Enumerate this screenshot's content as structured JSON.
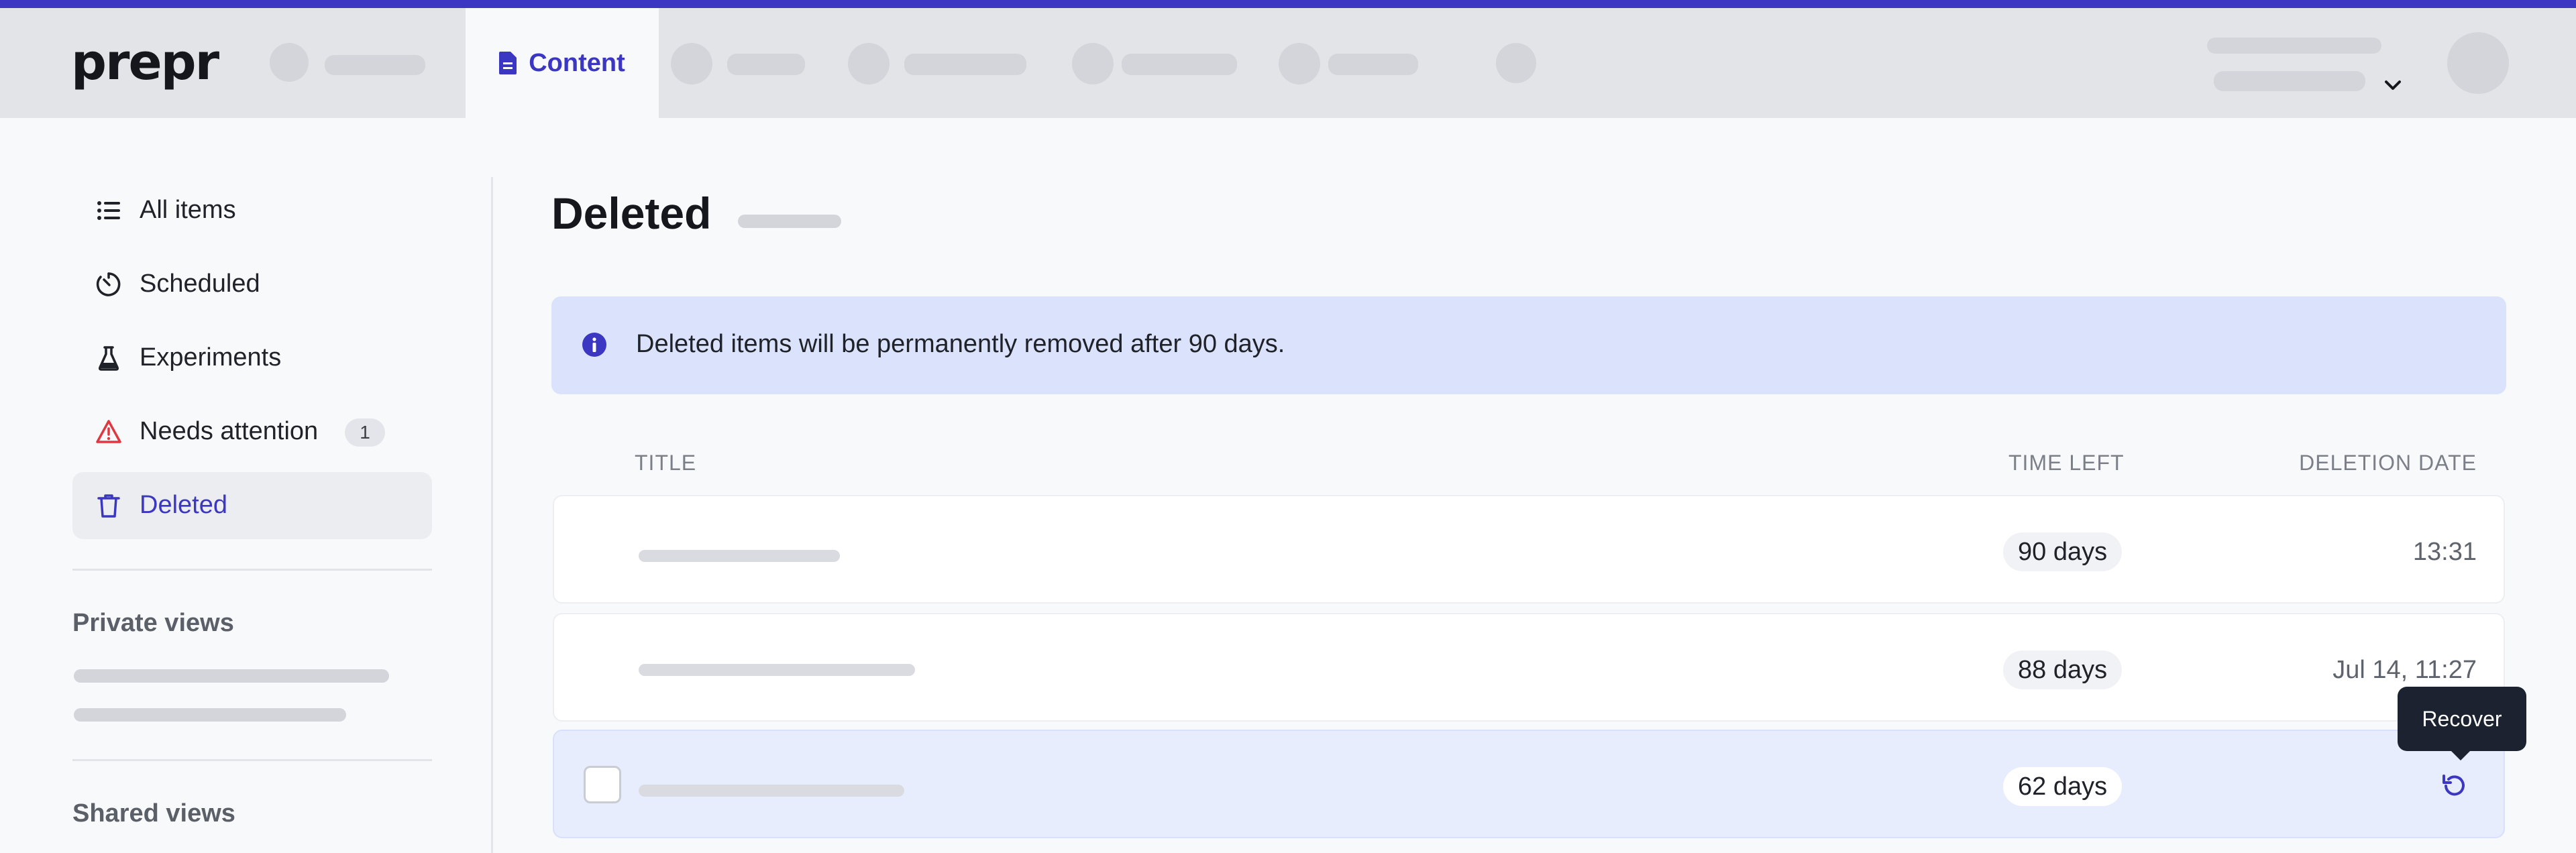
{
  "app": {
    "logo_text": "prepr"
  },
  "topnav": {
    "active_tab": {
      "label": "Content",
      "icon": "document-icon"
    }
  },
  "sidebar": {
    "items": [
      {
        "label": "All items",
        "icon": "list-icon"
      },
      {
        "label": "Scheduled",
        "icon": "timer-icon"
      },
      {
        "label": "Experiments",
        "icon": "flask-icon"
      },
      {
        "label": "Needs attention",
        "icon": "warning-icon",
        "badge": "1"
      },
      {
        "label": "Deleted",
        "icon": "trash-icon",
        "active": true
      }
    ],
    "private_views_title": "Private views",
    "shared_views_title": "Shared views"
  },
  "main": {
    "title": "Deleted",
    "info_banner": "Deleted items will be permanently removed after 90 days.",
    "columns": {
      "title": "TITLE",
      "time_left": "TIME LEFT",
      "deletion_date": "DELETION DATE"
    },
    "rows": [
      {
        "time_left": "90 days",
        "deletion_date": "13:31"
      },
      {
        "time_left": "88 days",
        "deletion_date": "Jul 14, 11:27"
      },
      {
        "time_left": "62 days",
        "deletion_date": ""
      }
    ],
    "tooltip": "Recover"
  },
  "colors": {
    "accent": "#3b37c2",
    "banner_bg": "#dbe3fc",
    "warning": "#e0383e",
    "tooltip_bg": "#1c2230"
  }
}
